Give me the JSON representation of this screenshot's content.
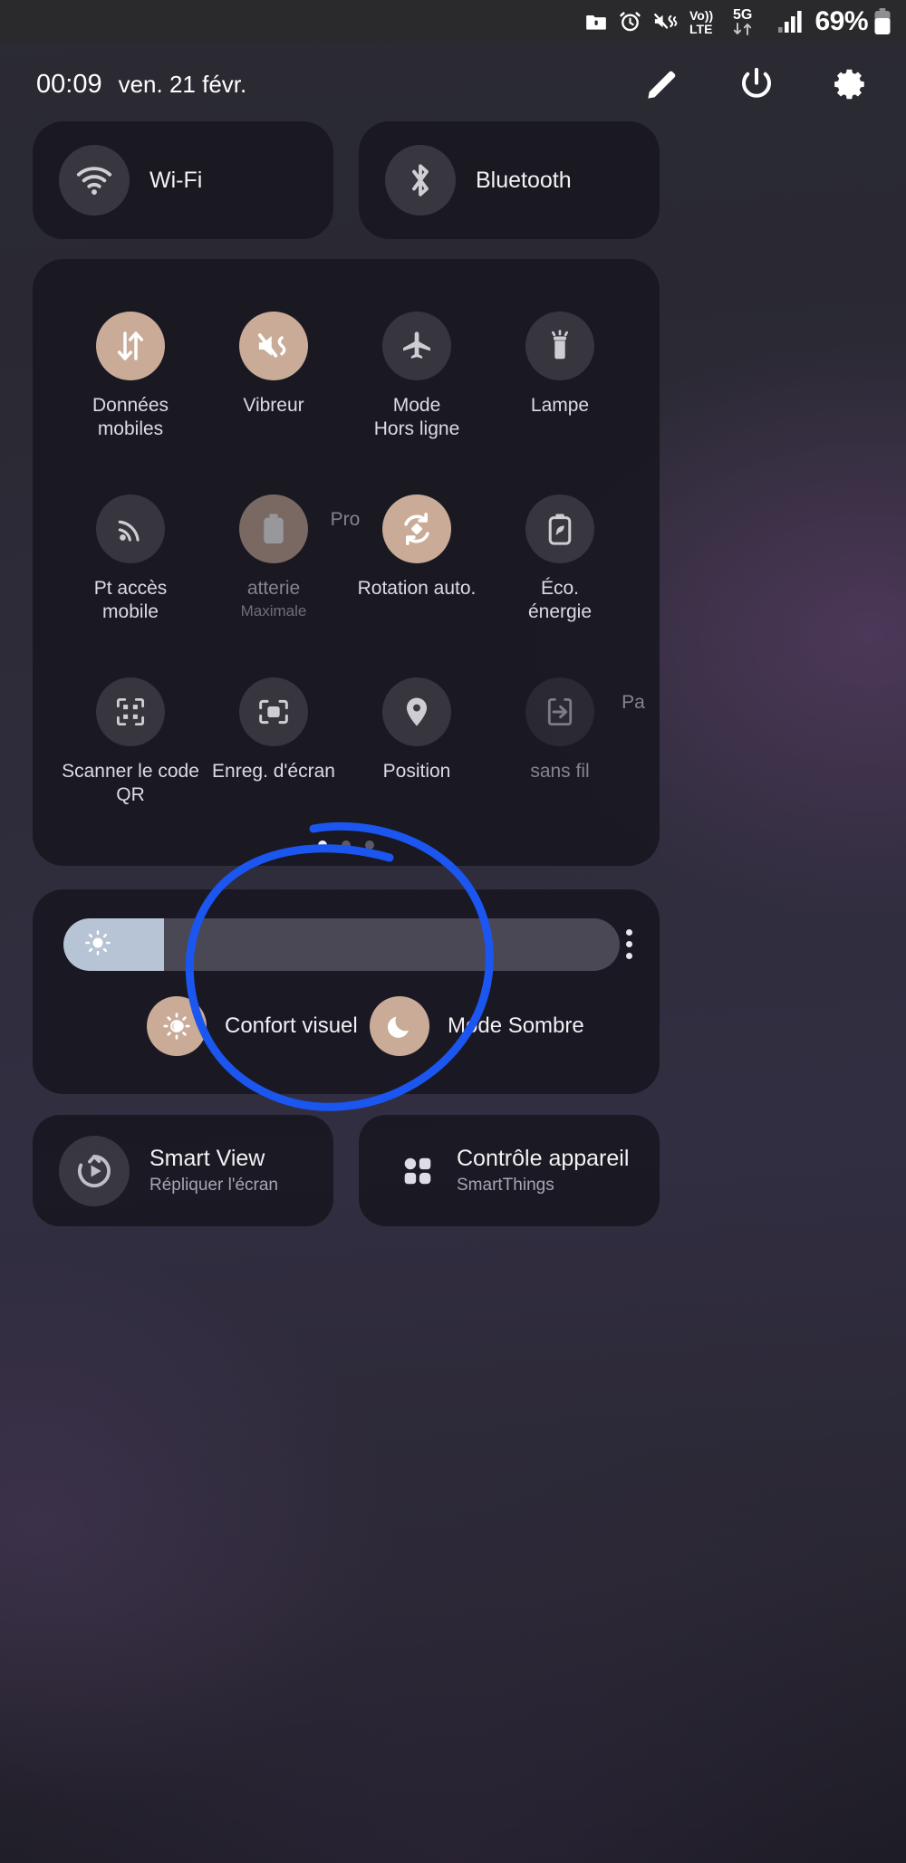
{
  "meta": {
    "device_ui": "Quick settings panel",
    "accent_on": "#c9ab97",
    "accent_off": "#ffffff21",
    "annotation_color": "#1b56f0",
    "panel_bg": "#181720"
  },
  "statusbar": {
    "icons": [
      "folder-lock-icon",
      "alarm-clock-icon",
      "vibrate-mute-icon",
      "volte-icon",
      "5g-data-icon",
      "signal-bars-icon"
    ],
    "volte_label_top": "Vo)",
    "volte_label_bottom": "LTE",
    "network_label": "5G",
    "battery_percent": "69%"
  },
  "header": {
    "time": "00:09",
    "date": "ven. 21 févr.",
    "actions": [
      {
        "name": "edit-pencil-button",
        "icon": "pencil-icon"
      },
      {
        "name": "power-button",
        "icon": "power-icon"
      },
      {
        "name": "settings-button",
        "icon": "gear-icon"
      }
    ]
  },
  "top_tiles": [
    {
      "name": "wifi-tile",
      "icon": "wifi-icon",
      "title": "Wi-Fi",
      "state": "off"
    },
    {
      "name": "bluetooth-tile",
      "icon": "bluetooth-icon",
      "title": "Bluetooth",
      "state": "off"
    }
  ],
  "quick_toggles": [
    {
      "name": "mobile-data-toggle",
      "icon": "data-arrows-icon",
      "label": "Données\nmobiles",
      "sub": "",
      "state": "on",
      "faded": false
    },
    {
      "name": "vibrate-toggle",
      "icon": "vibrate-icon",
      "label": "Vibreur",
      "sub": "",
      "state": "on",
      "faded": false
    },
    {
      "name": "airplane-mode-toggle",
      "icon": "airplane-icon",
      "label": "Mode\nHors ligne",
      "sub": "",
      "state": "off",
      "faded": false
    },
    {
      "name": "flashlight-toggle",
      "icon": "flashlight-icon",
      "label": "Lampe",
      "sub": "",
      "state": "off",
      "faded": false
    },
    {
      "name": "mobile-hotspot-toggle",
      "icon": "hotspot-icon",
      "label": "Pt accès\nmobile",
      "sub": "",
      "state": "off",
      "faded": false
    },
    {
      "name": "battery-toggle",
      "icon": "battery-icon",
      "label": "atterie",
      "sub": "Maximale",
      "state": "on",
      "faded": true
    },
    {
      "name": "battery-profile-label",
      "icon": "",
      "label": "Pro",
      "sub": "",
      "state": "none",
      "faded": true
    },
    {
      "name": "auto-rotate-toggle",
      "icon": "auto-rotate-icon",
      "label": "Rotation auto.",
      "sub": "",
      "state": "on",
      "faded": false
    },
    {
      "name": "power-saving-toggle",
      "icon": "leaf-battery-icon",
      "label": "Éco.\nénergie",
      "sub": "",
      "state": "off",
      "faded": false
    },
    {
      "name": "qr-scanner-toggle",
      "icon": "qr-code-icon",
      "label": "Scanner le code\nQR",
      "sub": "",
      "state": "off",
      "faded": false
    },
    {
      "name": "screen-recorder-toggle",
      "icon": "screen-record-icon",
      "label": "Enreg. d'écran",
      "sub": "",
      "state": "off",
      "faded": false
    },
    {
      "name": "location-toggle",
      "icon": "location-pin-icon",
      "label": "Position",
      "sub": "",
      "state": "off",
      "faded": false
    },
    {
      "name": "wireless-share-toggle",
      "icon": "share-arrow-icon",
      "label": "sans fil",
      "sub": "",
      "state": "off",
      "faded": true
    },
    {
      "name": "partial-next-label",
      "icon": "",
      "label": "Pa",
      "sub": "",
      "state": "none",
      "faded": true
    }
  ],
  "pager": {
    "total": 3,
    "active_index": 0
  },
  "brightness": {
    "name": "brightness-slider",
    "icon": "brightness-sun-icon",
    "fill_percent": 18,
    "more_options_icon": "more-vertical-icon"
  },
  "display_modes": [
    {
      "name": "eye-comfort-shield-toggle",
      "icon": "eye-comfort-icon",
      "label": "Confort visuel",
      "state": "on"
    },
    {
      "name": "dark-mode-toggle",
      "icon": "moon-icon",
      "label": "Mode Sombre",
      "state": "on"
    }
  ],
  "bottom_tiles": [
    {
      "name": "smart-view-tile",
      "icon": "smart-view-icon",
      "title": "Smart View",
      "sub": "Répliquer l'écran"
    },
    {
      "name": "device-control-tile",
      "icon": "device-control-icon",
      "title": "Contrôle appareil",
      "sub": "SmartThings"
    }
  ]
}
